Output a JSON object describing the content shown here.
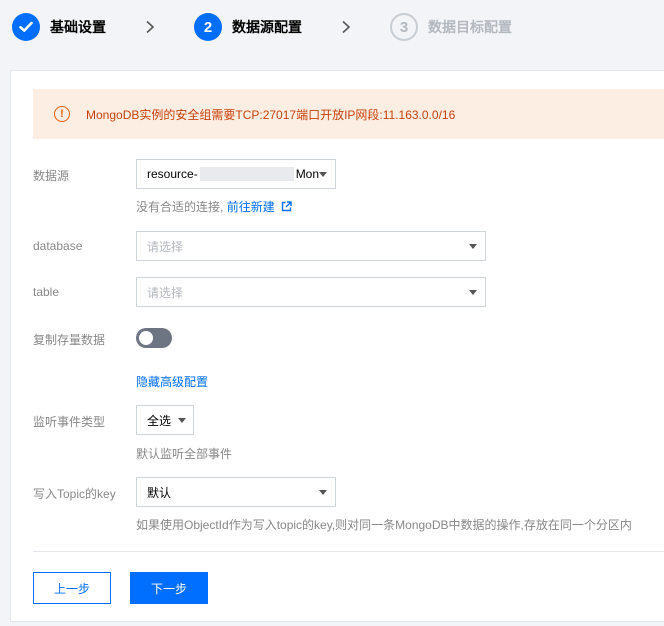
{
  "steps": [
    {
      "index": "1",
      "label": "基础设置",
      "state": "done"
    },
    {
      "index": "2",
      "label": "数据源配置",
      "state": "active"
    },
    {
      "index": "3",
      "label": "数据目标配置",
      "state": "todo"
    }
  ],
  "alert": {
    "icon": "warning-icon",
    "text": "MongoDB实例的安全组需要TCP:27017端口开放IP网段:11.163.0.0/16"
  },
  "form": {
    "datasource": {
      "label": "数据源",
      "value_prefix": "resource-",
      "value_suffix": "Mon",
      "hint_text": "没有合适的连接,",
      "hint_link": "前往新建"
    },
    "database": {
      "label": "database",
      "placeholder": "请选择"
    },
    "table": {
      "label": "table",
      "placeholder": "请选择"
    },
    "copy_existing": {
      "label": "复制存量数据",
      "enabled": false
    },
    "advanced_link": "隐藏高级配置",
    "event_type": {
      "label": "监听事件类型",
      "value": "全选",
      "hint": "默认监听全部事件"
    },
    "topic_key": {
      "label": "写入Topic的key",
      "value": "默认",
      "hint": "如果使用ObjectId作为写入topic的key,则对同一条MongoDB中数据的操作,存放在同一个分区内"
    }
  },
  "buttons": {
    "prev": "上一步",
    "next": "下一步"
  },
  "colors": {
    "primary": "#006eff",
    "warning_bg": "#fdeee3",
    "warning_text": "#c6410b"
  }
}
